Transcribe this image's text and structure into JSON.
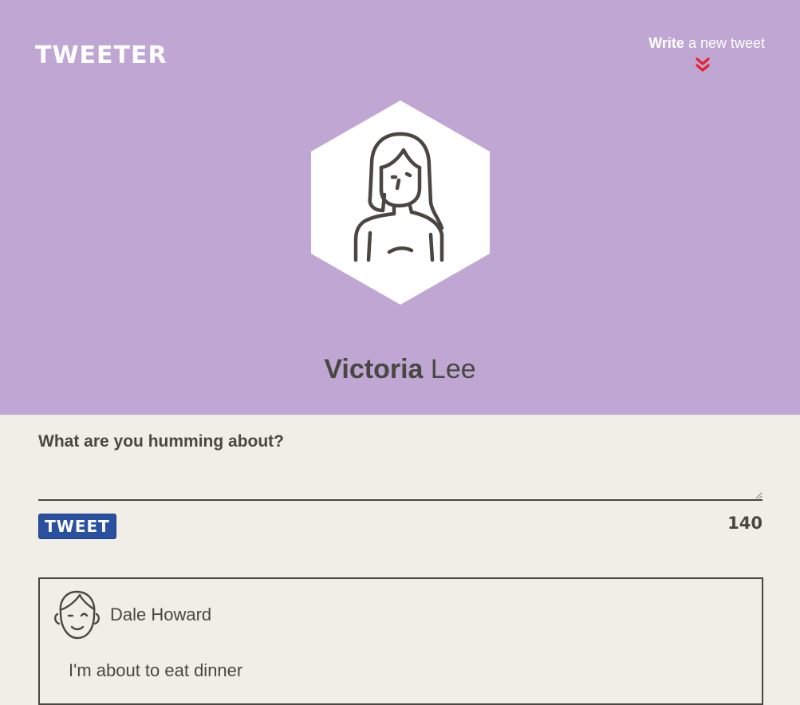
{
  "header": {
    "brand": "TWEETER",
    "compose_toggle": {
      "bold": "Write",
      "light": "a new tweet"
    },
    "profile": {
      "first_name": "Victoria",
      "last_name": "Lee"
    },
    "background_color": "#bfa6d3",
    "chevron_color": "#e8212f"
  },
  "compose": {
    "label": "What are you humming about?",
    "textarea_value": "",
    "button_label": "TWEET",
    "counter": "140",
    "button_color": "#2a50a0"
  },
  "tweets": [
    {
      "author": "Dale Howard",
      "content": "I'm about to eat dinner"
    }
  ],
  "icons": {
    "chevron": "double-chevron-down-icon",
    "profile_avatar": "woman-avatar-icon",
    "tweet_avatar": "man-avatar-icon"
  }
}
